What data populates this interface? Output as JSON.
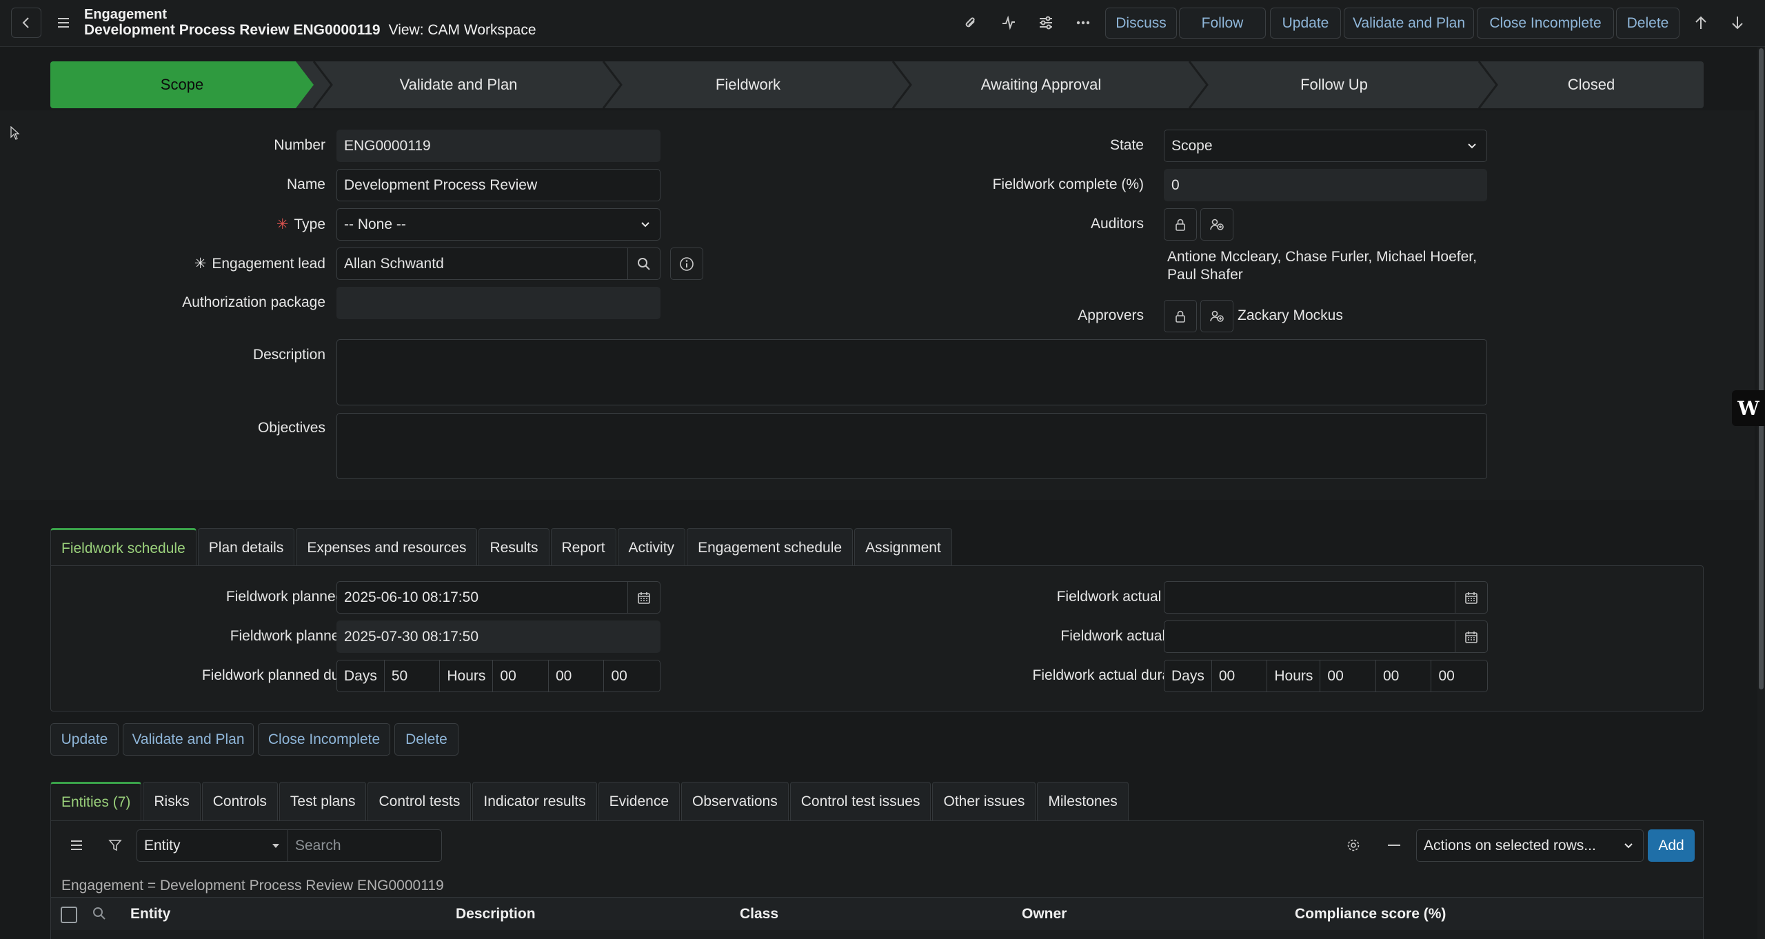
{
  "header": {
    "record_type": "Engagement",
    "record_title": "Development Process Review ENG0000119",
    "view_label": "View: CAM Workspace",
    "buttons": {
      "discuss": "Discuss",
      "follow": "Follow",
      "update": "Update",
      "validate_plan": "Validate and Plan",
      "close_incomplete": "Close Incomplete",
      "delete": "Delete"
    }
  },
  "stages": [
    "Scope",
    "Validate and Plan",
    "Fieldwork",
    "Awaiting Approval",
    "Follow Up",
    "Closed"
  ],
  "form": {
    "number_label": "Number",
    "number_value": "ENG0000119",
    "name_label": "Name",
    "name_value": "Development Process Review",
    "type_label": "Type",
    "type_value": "-- None --",
    "lead_label": "Engagement lead",
    "lead_value": "Allan Schwantd",
    "auth_label": "Authorization package",
    "auth_value": "",
    "description_label": "Description",
    "objectives_label": "Objectives",
    "state_label": "State",
    "state_value": "Scope",
    "fieldwork_complete_label": "Fieldwork complete (%)",
    "fieldwork_complete_value": "0",
    "auditors_label": "Auditors",
    "auditors_line1": "Antione Mccleary, Chase Furler, Michael Hoefer,",
    "auditors_line2": "Paul Shafer",
    "approvers_label": "Approvers",
    "approvers_value": "Zackary Mockus"
  },
  "tabs_top": [
    "Fieldwork schedule",
    "Plan details",
    "Expenses and resources",
    "Results",
    "Report",
    "Activity",
    "Engagement schedule",
    "Assignment"
  ],
  "schedule": {
    "planned_start_label": "Fieldwork planned start",
    "planned_start_value": "2025-06-10 08:17:50",
    "planned_end_label": "Fieldwork planned end",
    "planned_end_value": "2025-07-30 08:17:50",
    "planned_duration_label": "Fieldwork planned duration",
    "planned_days": "50",
    "planned_h": "00",
    "planned_m": "00",
    "planned_s": "00",
    "actual_start_label": "Fieldwork actual start",
    "actual_end_label": "Fieldwork actual end",
    "actual_duration_label": "Fieldwork actual duration",
    "actual_days": "00",
    "actual_h": "00",
    "actual_m": "00",
    "actual_s": "00",
    "days_label": "Days",
    "hours_label": "Hours"
  },
  "bottom_buttons": [
    "Update",
    "Validate and Plan",
    "Close Incomplete",
    "Delete"
  ],
  "tabs_related": [
    "Entities (7)",
    "Risks",
    "Controls",
    "Test plans",
    "Control tests",
    "Indicator results",
    "Evidence",
    "Observations",
    "Control test issues",
    "Other issues",
    "Milestones"
  ],
  "list": {
    "filter_field": "Entity",
    "search_placeholder": "Search",
    "actions_select": "Actions on selected rows...",
    "add_label": "Add",
    "breadcrumb": "Engagement = Development Process Review ENG0000119",
    "columns": [
      "Entity",
      "Description",
      "Class",
      "Owner",
      "Compliance score (%)"
    ]
  },
  "icons": [
    "back-icon",
    "menu-icon",
    "attachment-icon",
    "activity-icon",
    "settings-sliders-icon",
    "more-icon",
    "arrow-up-icon",
    "arrow-down-icon",
    "search-icon",
    "info-icon",
    "lock-icon",
    "add-user-icon",
    "calendar-icon",
    "filter-icon",
    "gear-icon",
    "chevron-down-icon"
  ],
  "colors": {
    "stage_active": "#2f9a3f",
    "link_blue": "#8fb6d9",
    "primary_button": "#1f6fa8",
    "required_star": "#d9534f"
  }
}
